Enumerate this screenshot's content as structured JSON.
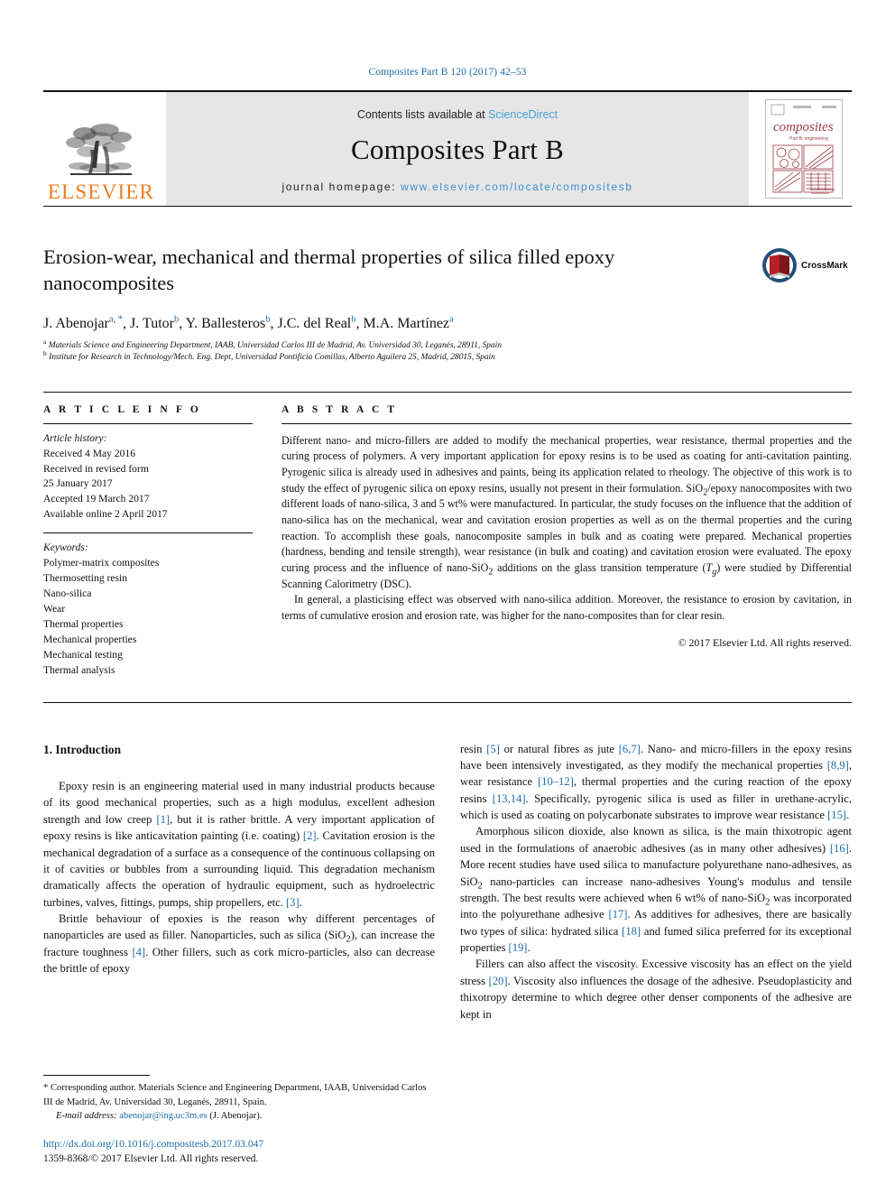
{
  "running_head": "Composites Part B 120 (2017) 42–53",
  "masthead": {
    "publisher_logo_text": "ELSEVIER",
    "contents_prefix": "Contents lists available at ",
    "contents_link": "ScienceDirect",
    "journal_title": "Composites Part B",
    "homepage_prefix": "journal homepage: ",
    "homepage_link": "www.elsevier.com/locate/compositesb",
    "cover_title": "composites",
    "cover_subtitle": "Part B: engineering"
  },
  "article": {
    "title": "Erosion-wear, mechanical and thermal properties of silica filled epoxy nanocomposites",
    "crossmark_label": "CrossMark",
    "authors": [
      {
        "name": "J. Abenojar",
        "marks": "a, *"
      },
      {
        "name": "J. Tutor",
        "marks": "b"
      },
      {
        "name": "Y. Ballesteros",
        "marks": "b"
      },
      {
        "name": "J.C. del Real",
        "marks": "b"
      },
      {
        "name": "M.A. Martínez",
        "marks": "a"
      }
    ],
    "affiliations": [
      {
        "mark": "a",
        "text": "Materials Science and Engineering Department, IAAB, Universidad Carlos III de Madrid, Av. Universidad 30, Leganés, 28911, Spain"
      },
      {
        "mark": "b",
        "text": "Institute for Research in Technology/Mech. Eng. Dept, Universidad Pontificia Comillas, Alberto Aguilera 25, Madrid, 28015, Spain"
      }
    ]
  },
  "article_info": {
    "heading": "A R T I C L E  I N F O",
    "history_label": "Article history:",
    "history": [
      "Received 4 May 2016",
      "Received in revised form",
      "25 January 2017",
      "Accepted 19 March 2017",
      "Available online 2 April 2017"
    ],
    "keywords_label": "Keywords:",
    "keywords": [
      "Polymer-matrix composites",
      "Thermosetting resin",
      "Nano-silica",
      "Wear",
      "Thermal properties",
      "Mechanical properties",
      "Mechanical testing",
      "Thermal analysis"
    ]
  },
  "abstract": {
    "heading": "A B S T R A C T",
    "paragraph_1": "Different nano- and micro-fillers are added to modify the mechanical properties, wear resistance, thermal properties and the curing process of polymers. A very important application for epoxy resins is to be used as coating for anti-cavitation painting. Pyrogenic silica is already used in adhesives and paints, being its application related to rheology. The objective of this work is to study the effect of pyrogenic silica on epoxy resins, usually not present in their formulation. SiO2/epoxy nanocomposites with two different loads of nano-silica, 3 and 5 wt% were manufactured. In particular, the study focuses on the influence that the addition of nano-silica has on the mechanical, wear and cavitation erosion properties as well as on the thermal properties and the curing reaction. To accomplish these goals, nanocomposite samples in bulk and as coating were prepared. Mechanical properties (hardness, bending and tensile strength), wear resistance (in bulk and coating) and cavitation erosion were evaluated. The epoxy curing process and the influence of nano-SiO2 additions on the glass transition temperature (Tg) were studied by Differential Scanning Calorimetry (DSC).",
    "paragraph_2": "In general, a plasticising effect was observed with nano-silica addition. Moreover, the resistance to erosion by cavitation, in terms of cumulative erosion and erosion rate, was higher for the nano-composites than for clear resin.",
    "copyright": "© 2017 Elsevier Ltd. All rights reserved."
  },
  "introduction": {
    "heading": "1. Introduction",
    "left_paragraphs": [
      "Epoxy resin is an engineering material used in many industrial products because of its good mechanical properties, such as a high modulus, excellent adhesion strength and low creep [1], but it is rather brittle. A very important application of epoxy resins is like anticavitation painting (i.e. coating) [2]. Cavitation erosion is the mechanical degradation of a surface as a consequence of the continuous collapsing on it of cavities or bubbles from a surrounding liquid. This degradation mechanism dramatically affects the operation of hydraulic equipment, such as hydroelectric turbines, valves, fittings, pumps, ship propellers, etc. [3].",
      "Brittle behaviour of epoxies is the reason why different percentages of nanoparticles are used as filler. Nanoparticles, such as silica (SiO2), can increase the fracture toughness [4]. Other fillers, such as cork micro-particles, also can decrease the brittle of epoxy"
    ],
    "right_paragraphs": [
      "resin [5] or natural fibres as jute [6,7]. Nano- and micro-fillers in the epoxy resins have been intensively investigated, as they modify the mechanical properties [8,9], wear resistance [10–12], thermal properties and the curing reaction of the epoxy resins [13,14]. Specifically, pyrogenic silica is used as filler in urethane-acrylic, which is used as coating on polycarbonate substrates to improve wear resistance [15].",
      "Amorphous silicon dioxide, also known as silica, is the main thixotropic agent used in the formulations of anaerobic adhesives (as in many other adhesives) [16]. More recent studies have used silica to manufacture polyurethane nano-adhesives, as SiO2 nano-particles can increase nano-adhesives Young's modulus and tensile strength. The best results were achieved when 6 wt% of nano-SiO2 was incorporated into the polyurethane adhesive [17]. As additives for adhesives, there are basically two types of silica: hydrated silica [18] and fumed silica preferred for its exceptional properties [19].",
      "Fillers can also affect the viscosity. Excessive viscosity has an effect on the yield stress [20]. Viscosity also influences the dosage of the adhesive. Pseudoplasticity and thixotropy determine to which degree other denser components of the adhesive are kept in"
    ]
  },
  "footer": {
    "corresponding_mark": "*",
    "corresponding_text": "Corresponding author. Materials Science and Engineering Department, IAAB, Universidad Carlos III de Madrid, Av. Universidad 30, Leganés, 28911, Spain.",
    "email_label": "E-mail address:",
    "email": "abenojar@ing.uc3m.es",
    "email_owner": "(J. Abenojar).",
    "doi": "http://dx.doi.org/10.1016/j.compositesb.2017.03.047",
    "issn_line": "1359-8368/© 2017 Elsevier Ltd. All rights reserved."
  },
  "colors": {
    "link_blue": "#1b6ca8",
    "elsevier_orange": "#F07C1E",
    "band_grey": "#e6e6e6",
    "crossmark_red": "#B42025"
  }
}
